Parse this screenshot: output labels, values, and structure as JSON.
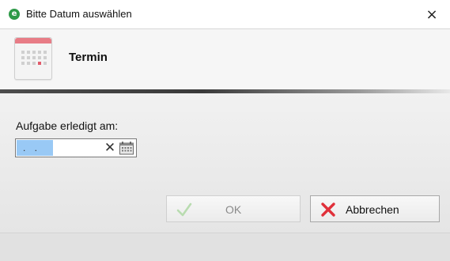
{
  "window": {
    "title": "Bitte Datum auswählen",
    "app_icon_letter": "e",
    "close_glyph": "×"
  },
  "header": {
    "title": "Termin",
    "icon": "calendar-icon"
  },
  "form": {
    "label": "Aufgabe erledigt am:",
    "date_value": ". .",
    "clear_glyph": "✕",
    "picker_icon": "calendar-picker-icon"
  },
  "buttons": {
    "ok_label": "OK",
    "cancel_label": "Abbrechen"
  },
  "colors": {
    "app_icon": "#2e9a48",
    "selection": "#99c9f5",
    "ok_check": "#b9dcb0",
    "cancel_x": "#e0303a",
    "calendar_header": "#e87c86"
  }
}
